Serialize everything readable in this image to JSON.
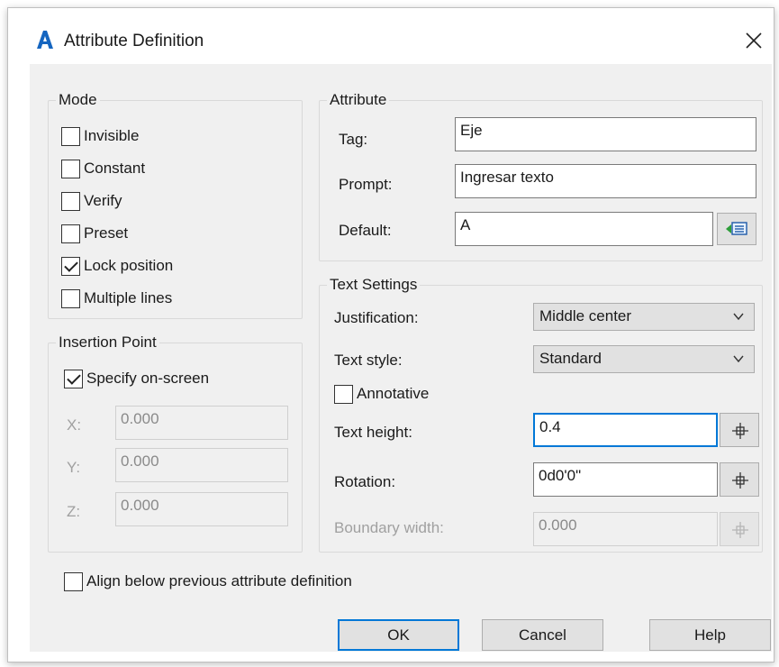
{
  "window": {
    "title": "Attribute Definition",
    "app_icon": "autocad-a-icon",
    "close_icon": "close-icon"
  },
  "mode": {
    "label": "Mode",
    "items": [
      {
        "label": "Invisible",
        "checked": false
      },
      {
        "label": "Constant",
        "checked": false
      },
      {
        "label": "Verify",
        "checked": false
      },
      {
        "label": "Preset",
        "checked": false
      },
      {
        "label": "Lock position",
        "checked": true
      },
      {
        "label": "Multiple lines",
        "checked": false
      }
    ]
  },
  "insertion_point": {
    "label": "Insertion Point",
    "specify_on_screen": {
      "label": "Specify on-screen",
      "checked": true
    },
    "x": {
      "label": "X:",
      "value": "0.000"
    },
    "y": {
      "label": "Y:",
      "value": "0.000"
    },
    "z": {
      "label": "Z:",
      "value": "0.000"
    }
  },
  "attribute": {
    "label": "Attribute",
    "tag": {
      "label": "Tag:",
      "value": "Eje"
    },
    "prompt": {
      "label": "Prompt:",
      "value": "Ingresar texto"
    },
    "default": {
      "label": "Default:",
      "value": "A"
    }
  },
  "text_settings": {
    "label": "Text Settings",
    "justification": {
      "label": "Justification:",
      "value": "Middle center"
    },
    "text_style": {
      "label": "Text style:",
      "value": "Standard"
    },
    "annotative": {
      "label": "Annotative",
      "checked": false
    },
    "text_height": {
      "label": "Text height:",
      "value": "0.4"
    },
    "rotation": {
      "label": "Rotation:",
      "value": "0d0'0\""
    },
    "boundary_width": {
      "label": "Boundary width:",
      "value": "0.000"
    }
  },
  "align_below": {
    "label": "Align below previous attribute definition",
    "checked": false
  },
  "buttons": {
    "ok": "OK",
    "cancel": "Cancel",
    "help": "Help"
  },
  "colors": {
    "dialog_bg": "#f0f0f0",
    "focus_border": "#0078d7",
    "button_bg": "#e1e1e1",
    "app_icon": "#1565c0"
  }
}
